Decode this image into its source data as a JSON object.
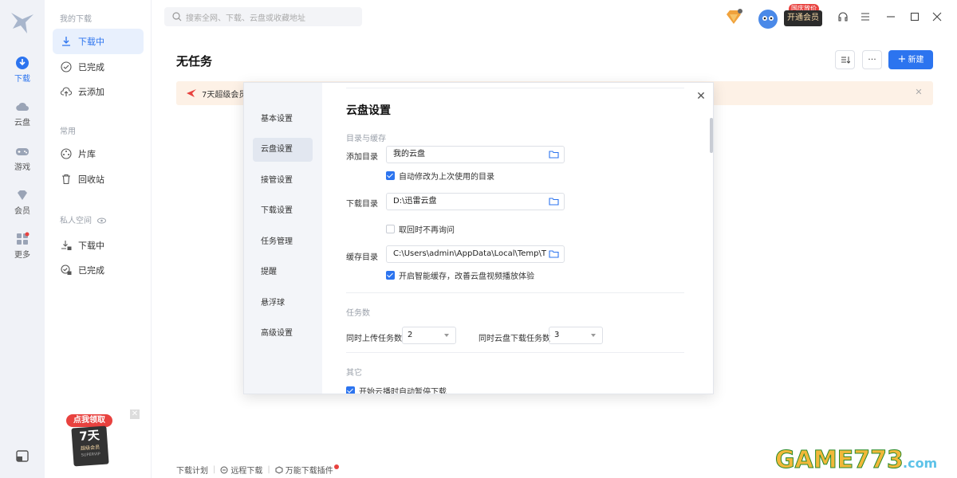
{
  "rail": {
    "items": [
      {
        "label": "下载",
        "icon": "download-icon",
        "active": true
      },
      {
        "label": "云盘",
        "icon": "cloud-icon"
      },
      {
        "label": "游戏",
        "icon": "gamepad-icon"
      },
      {
        "label": "会员",
        "icon": "diamond-icon"
      },
      {
        "label": "更多",
        "icon": "grid-icon"
      }
    ]
  },
  "sidebar": {
    "my_downloads_header": "我的下载",
    "items": [
      {
        "label": "下载中",
        "icon": "download-icon"
      },
      {
        "label": "已完成",
        "icon": "check-circle-icon"
      },
      {
        "label": "云添加",
        "icon": "cloud-upload-icon"
      }
    ],
    "common_header": "常用",
    "common_items": [
      {
        "label": "片库",
        "icon": "film-icon"
      },
      {
        "label": "回收站",
        "icon": "trash-icon"
      }
    ],
    "private_header": "私人空间",
    "private_items": [
      {
        "label": "下载中",
        "icon": "lock-download-icon"
      },
      {
        "label": "已完成",
        "icon": "lock-check-icon"
      }
    ],
    "promo": {
      "line1": "点我领取",
      "line2": "7天",
      "line3": "超级会员",
      "line4": "SUPERVIP"
    }
  },
  "header": {
    "search_placeholder": "搜索全网、下载、云盘或收藏地址",
    "vip_button": "开通会员",
    "vip_tag": "国庆放价"
  },
  "main": {
    "title": "无任务",
    "new_button": "新建",
    "banner_text": "7天超级会员",
    "footer": [
      "下载计划",
      "远程下载",
      "万能下载插件"
    ]
  },
  "dialog": {
    "nav": [
      "基本设置",
      "云盘设置",
      "接管设置",
      "下载设置",
      "任务管理",
      "提醒",
      "悬浮球",
      "高级设置"
    ],
    "active_index": 1,
    "title": "云盘设置",
    "section_dir": "目录与缓存",
    "add_dir_label": "添加目录",
    "add_dir_value": "我的云盘",
    "auto_modify": "自动修改为上次使用的目录",
    "download_dir_label": "下载目录",
    "download_dir_value": "D:\\迅雷云盘",
    "no_ask": "取回时不再询问",
    "cache_dir_label": "缓存目录",
    "cache_dir_value": "C:\\Users\\admin\\AppData\\Local\\Temp\\T",
    "smart_cache": "开启智能缓存，改善云盘视频播放体验",
    "section_tasks": "任务数",
    "upload_label": "同时上传任务数",
    "upload_value": "2",
    "cloud_download_label": "同时云盘下载任务数",
    "cloud_download_value": "3",
    "section_other": "其它",
    "auto_pause": "开始云播时自动暂停下载"
  },
  "watermark": "GAME773.com",
  "colors": {
    "accent": "#2c74ef",
    "banner_bg": "#fdf1e6",
    "red": "#e8423f"
  }
}
